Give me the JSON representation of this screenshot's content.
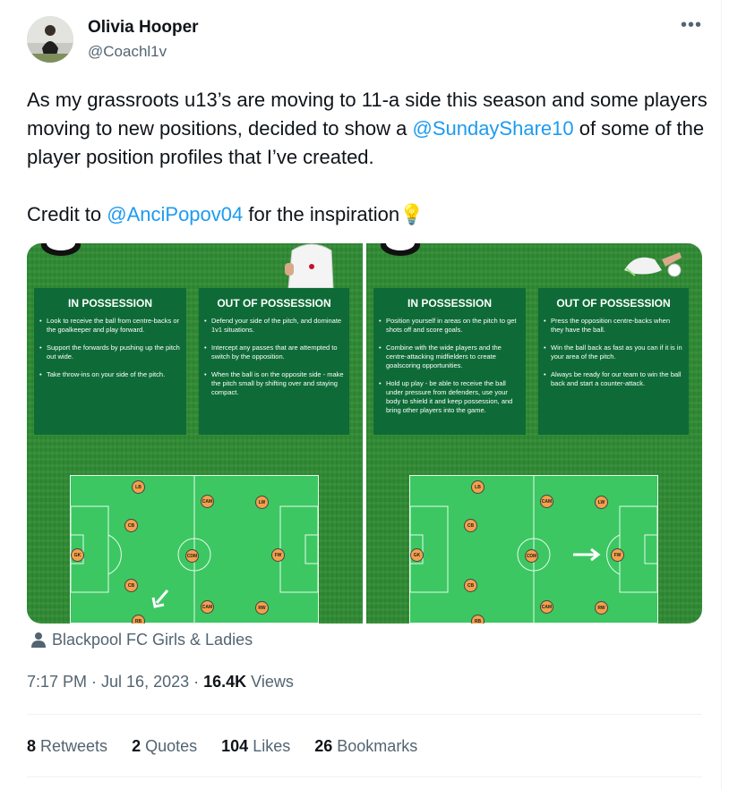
{
  "author": {
    "name": "Olivia Hooper",
    "handle": "@Coachl1v",
    "more_icon": "more-options-icon"
  },
  "tweet": {
    "line1": "As my grassroots u13’s are moving to 11-a side this season and some players moving to new positions, decided to show a ",
    "mention1": "@SundayShare10",
    "line1_end": " of some of the player position profiles that I’ve created.",
    "line2_start": "Credit to ",
    "mention2": "@AnciPopov04",
    "line2_end": " for the inspiration💡"
  },
  "images": [
    {
      "in_title": "IN POSSESSION",
      "in_items": [
        "Look to receive the ball from centre-backs or the goalkeeper and play forward.",
        "Support the forwards by pushing up the pitch out wide.",
        "Take throw-ins on your side of the pitch."
      ],
      "out_title": "OUT OF POSSESSION",
      "out_items": [
        "Defend your side of the pitch, and dominate 1v1 situations.",
        "Intercept any passes that are attempted to switch by the opposition.",
        "When the ball is on the opposite side - make the pitch small by shifting over and staying compact."
      ],
      "players": [
        "LB",
        "CB",
        "GK",
        "CB",
        "RB",
        "CAM",
        "CDM",
        "CAM",
        "LW",
        "FW",
        "RW"
      ]
    },
    {
      "in_title": "IN POSSESSION",
      "in_items": [
        "Position yourself in areas on the pitch to get shots off and score goals.",
        "Combine with the wide players and the centre-attacking midfielders to create goalscoring opportunities.",
        "Hold up play - be able to receive the ball under pressure from defenders, use your body to shield it and keep possession, and bring other players into the game."
      ],
      "out_title": "OUT OF POSSESSION",
      "out_items": [
        "Press the opposition centre-backs when they have the ball.",
        "Win the ball back as fast as you can if it is in your area of the pitch.",
        "Always be ready for our team to win the ball back and start a counter-attack."
      ],
      "players": [
        "LB",
        "CB",
        "GK",
        "CB",
        "RB",
        "CAM",
        "CDM",
        "CAM",
        "LW",
        "FW",
        "RW"
      ]
    }
  ],
  "location": "Blackpool FC Girls & Ladies",
  "meta": {
    "time": "7:17 PM · Jul 16, 2023 · ",
    "views": "16.4K",
    "views_label": " Views"
  },
  "stats": {
    "retweets": "8",
    "retweets_label": " Retweets",
    "quotes": "2",
    "quotes_label": " Quotes",
    "likes": "104",
    "likes_label": " Likes",
    "bookmarks": "26",
    "bookmarks_label": " Bookmarks"
  },
  "colors": {
    "link": "#1d9bf0",
    "muted": "#536471",
    "pitch": "#3cc763",
    "box": "#0e6b37",
    "player": "#f4a04b"
  }
}
